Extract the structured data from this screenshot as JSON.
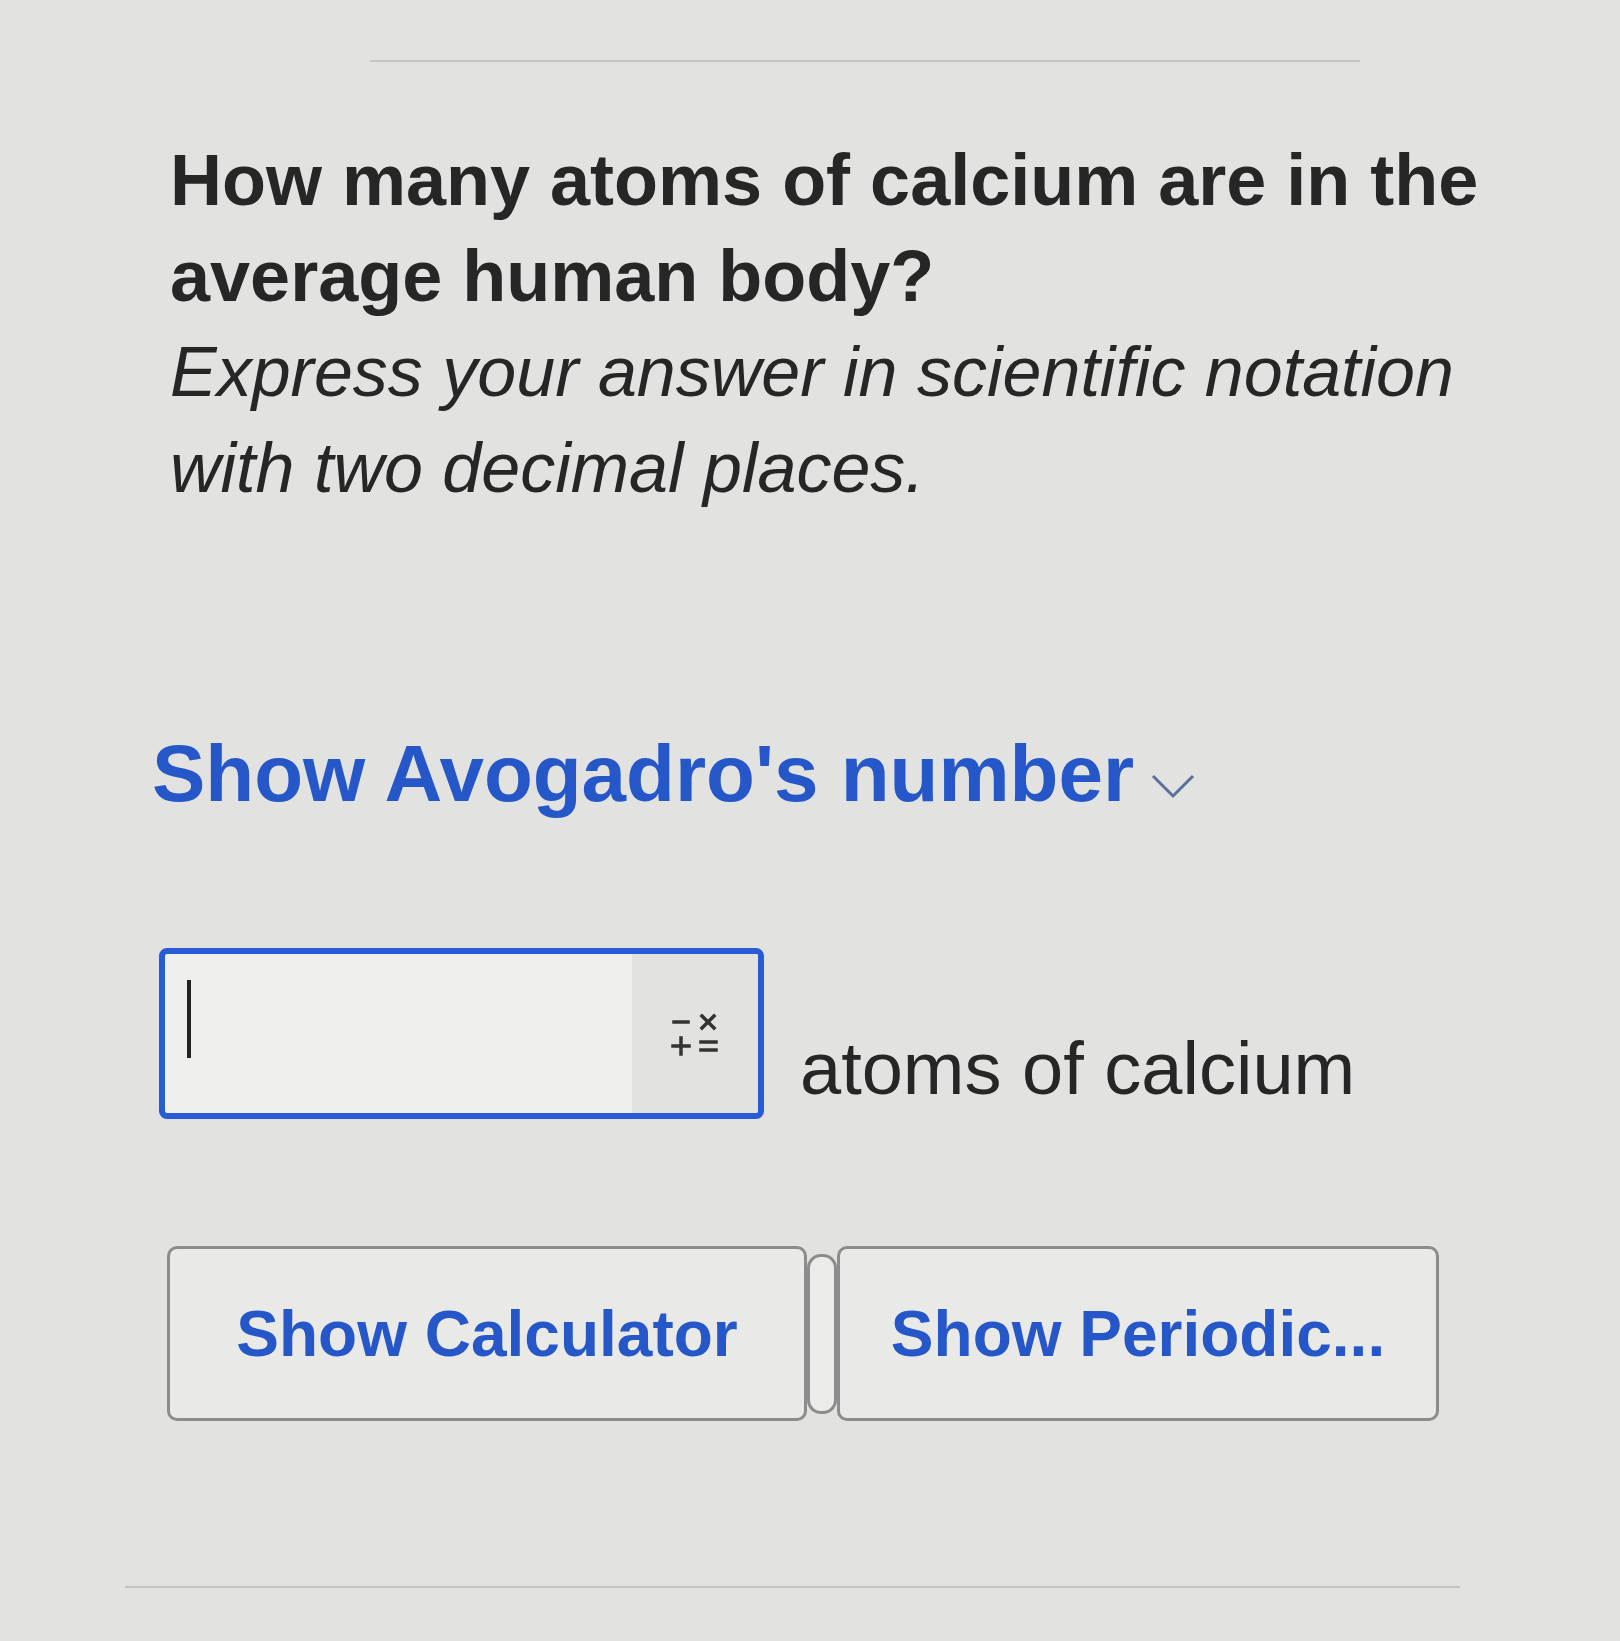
{
  "question": {
    "prompt": "How many atoms of calcium are in the average human body?",
    "instruction": "Express your answer in scientific notation with two decimal places."
  },
  "hint_toggle": {
    "label": "Show Avogadro's number",
    "expanded": false
  },
  "answer": {
    "focused": true,
    "unit": "atoms of calcium"
  },
  "buttons": [
    {
      "label": "Show Calculator"
    },
    {
      "label": "Show Periodic..."
    }
  ]
}
